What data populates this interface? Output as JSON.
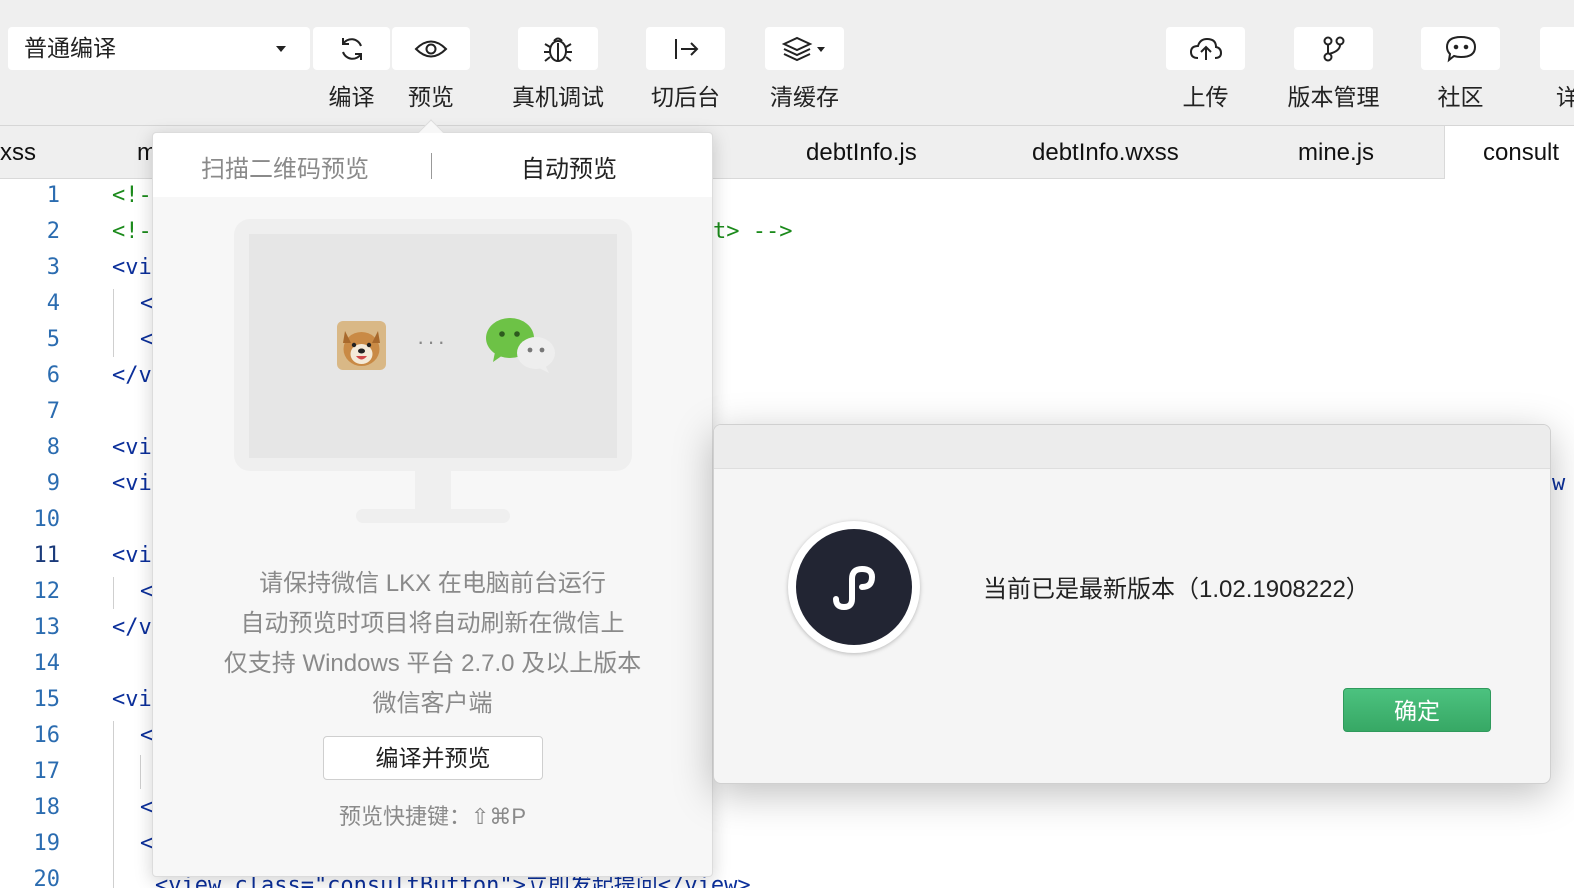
{
  "toolbar": {
    "mode_select": "普通编译",
    "buttons": [
      {
        "label": "编译",
        "icon": "refresh-icon"
      },
      {
        "label": "预览",
        "icon": "eye-icon"
      },
      {
        "label": "真机调试",
        "icon": "bug-icon"
      },
      {
        "label": "切后台",
        "icon": "switch-background-icon"
      },
      {
        "label": "清缓存",
        "icon": "layers-icon"
      },
      {
        "label": "上传",
        "icon": "cloud-upload-icon"
      },
      {
        "label": "版本管理",
        "icon": "branch-icon"
      },
      {
        "label": "社区",
        "icon": "chat-bubble-icon"
      },
      {
        "label": "详"
      }
    ]
  },
  "tabs": [
    "xss",
    "m",
    "debtInfo.js",
    "debtInfo.wxss",
    "mine.js",
    "consult"
  ],
  "editor": {
    "line_numbers": [
      "1",
      "2",
      "3",
      "4",
      "5",
      "6",
      "7",
      "8",
      "9",
      "10",
      "11",
      "12",
      "13",
      "14",
      "15",
      "16",
      "17",
      "18",
      "19",
      "20"
    ],
    "lines": {
      "l1": "<!-",
      "l2": "<!-",
      "l2_tail": "t> -->",
      "l3": "<vi",
      "l4": "<",
      "l5": "<",
      "l6": "</v",
      "l8": "<vi",
      "l9": "<vi",
      "l9_tail": "w",
      "l11": "<vi",
      "l12": "<",
      "l13": "</v",
      "l15": "<vi",
      "l16": "<",
      "l18": "<",
      "l19": "<",
      "l20": "<view class=\"consultButton\">立即发起提问</view>"
    }
  },
  "preview_popover": {
    "tab_scan": "扫描二维码预览",
    "tab_auto": "自动预览",
    "separator": "|",
    "dots": "···",
    "description": [
      "请保持微信 LKX 在电脑前台运行",
      "自动预览时项目将自动刷新在微信上",
      "仅支持 Windows 平台 2.7.0 及以上版本",
      "微信客户端"
    ],
    "compile_preview_button": "编译并预览",
    "shortcut": "预览快捷键：⇧⌘P"
  },
  "dialog": {
    "message": "当前已是最新版本（1.02.1908222）",
    "ok_button": "确定",
    "logo_icon": "miniprogram-logo-icon"
  },
  "colors": {
    "ok_button": "#3cb371",
    "comment": "#1b8a1b",
    "tag": "#0b2f9a",
    "logo_bg": "#222533"
  }
}
